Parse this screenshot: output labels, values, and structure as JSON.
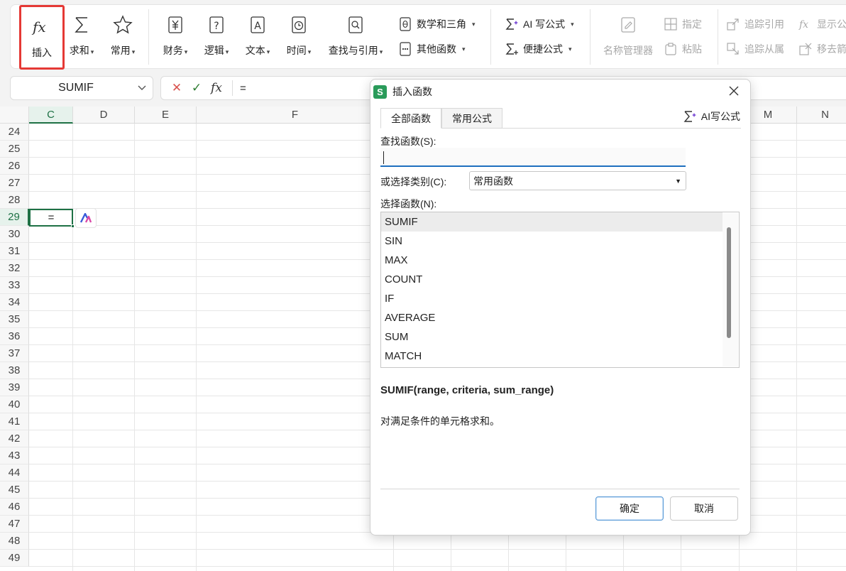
{
  "ribbon": {
    "insert_label": "插入",
    "sum_label": "求和",
    "common_label": "常用",
    "finance_label": "财务",
    "logic_label": "逻辑",
    "text_label": "文本",
    "time_label": "时间",
    "lookup_label": "查找与引用",
    "math_label": "数学和三角",
    "other_label": "其他函数",
    "ai_formula_label": "AI 写公式",
    "quick_formula_label": "便捷公式",
    "name_manager_label": "名称管理器",
    "specify_label": "指定",
    "paste_label": "粘贴",
    "trace_precedents_label": "追踪引用",
    "trace_dependents_label": "追踪从属",
    "show_formulas_label": "显示公",
    "remove_arrows_label": "移去箭"
  },
  "formula_bar": {
    "name_box": "SUMIF",
    "content": "="
  },
  "sheet": {
    "columns": [
      "C",
      "D",
      "E",
      "F",
      "M",
      "N"
    ],
    "rows": [
      "24",
      "25",
      "26",
      "27",
      "28",
      "29",
      "30",
      "31",
      "32",
      "33",
      "34",
      "35",
      "36",
      "37",
      "38",
      "39",
      "40",
      "41",
      "42",
      "43",
      "44",
      "45",
      "46",
      "47",
      "48",
      "49"
    ],
    "active_cell_value": "="
  },
  "dialog": {
    "title": "插入函数",
    "app_icon": "S",
    "tabs": [
      "全部函数",
      "常用公式"
    ],
    "ai_link": "AI写公式",
    "search_label": "查找函数(S):",
    "search_value": "",
    "category_label": "或选择类别(C):",
    "category_value": "常用函数",
    "list_label": "选择函数(N):",
    "functions": [
      "SUMIF",
      "SIN",
      "MAX",
      "COUNT",
      "IF",
      "AVERAGE",
      "SUM",
      "MATCH"
    ],
    "selected_function": "SUMIF",
    "signature": "SUMIF(range, criteria, sum_range)",
    "description": "对满足条件的单元格求和。",
    "ok_label": "确定",
    "cancel_label": "取消"
  },
  "colors": {
    "accent_green": "#1e7145",
    "highlight_red": "#e53935",
    "app_green": "#2a9b5a"
  }
}
